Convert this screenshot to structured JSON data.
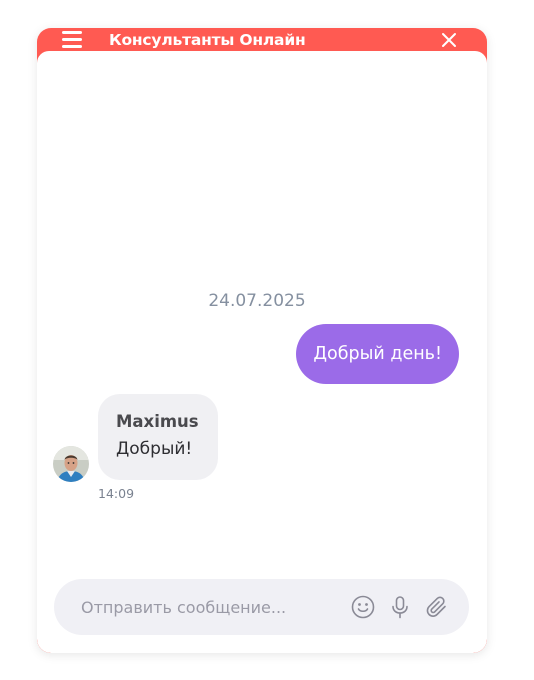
{
  "header": {
    "title": "Консультанты Онлайн",
    "menu_icon": "hamburger-menu-icon",
    "close_icon": "close-icon",
    "color": "#ff5a52"
  },
  "chat": {
    "date": "24.07.2025",
    "messages": [
      {
        "direction": "outgoing",
        "text": "Добрый день!",
        "color": "#9b6be8"
      },
      {
        "direction": "incoming",
        "sender": "Maximus",
        "text": "Добрый!",
        "time": "14:09"
      }
    ]
  },
  "composer": {
    "placeholder": "Отправить сообщение...",
    "icons": [
      "emoji-icon",
      "microphone-icon",
      "paperclip-icon"
    ]
  }
}
